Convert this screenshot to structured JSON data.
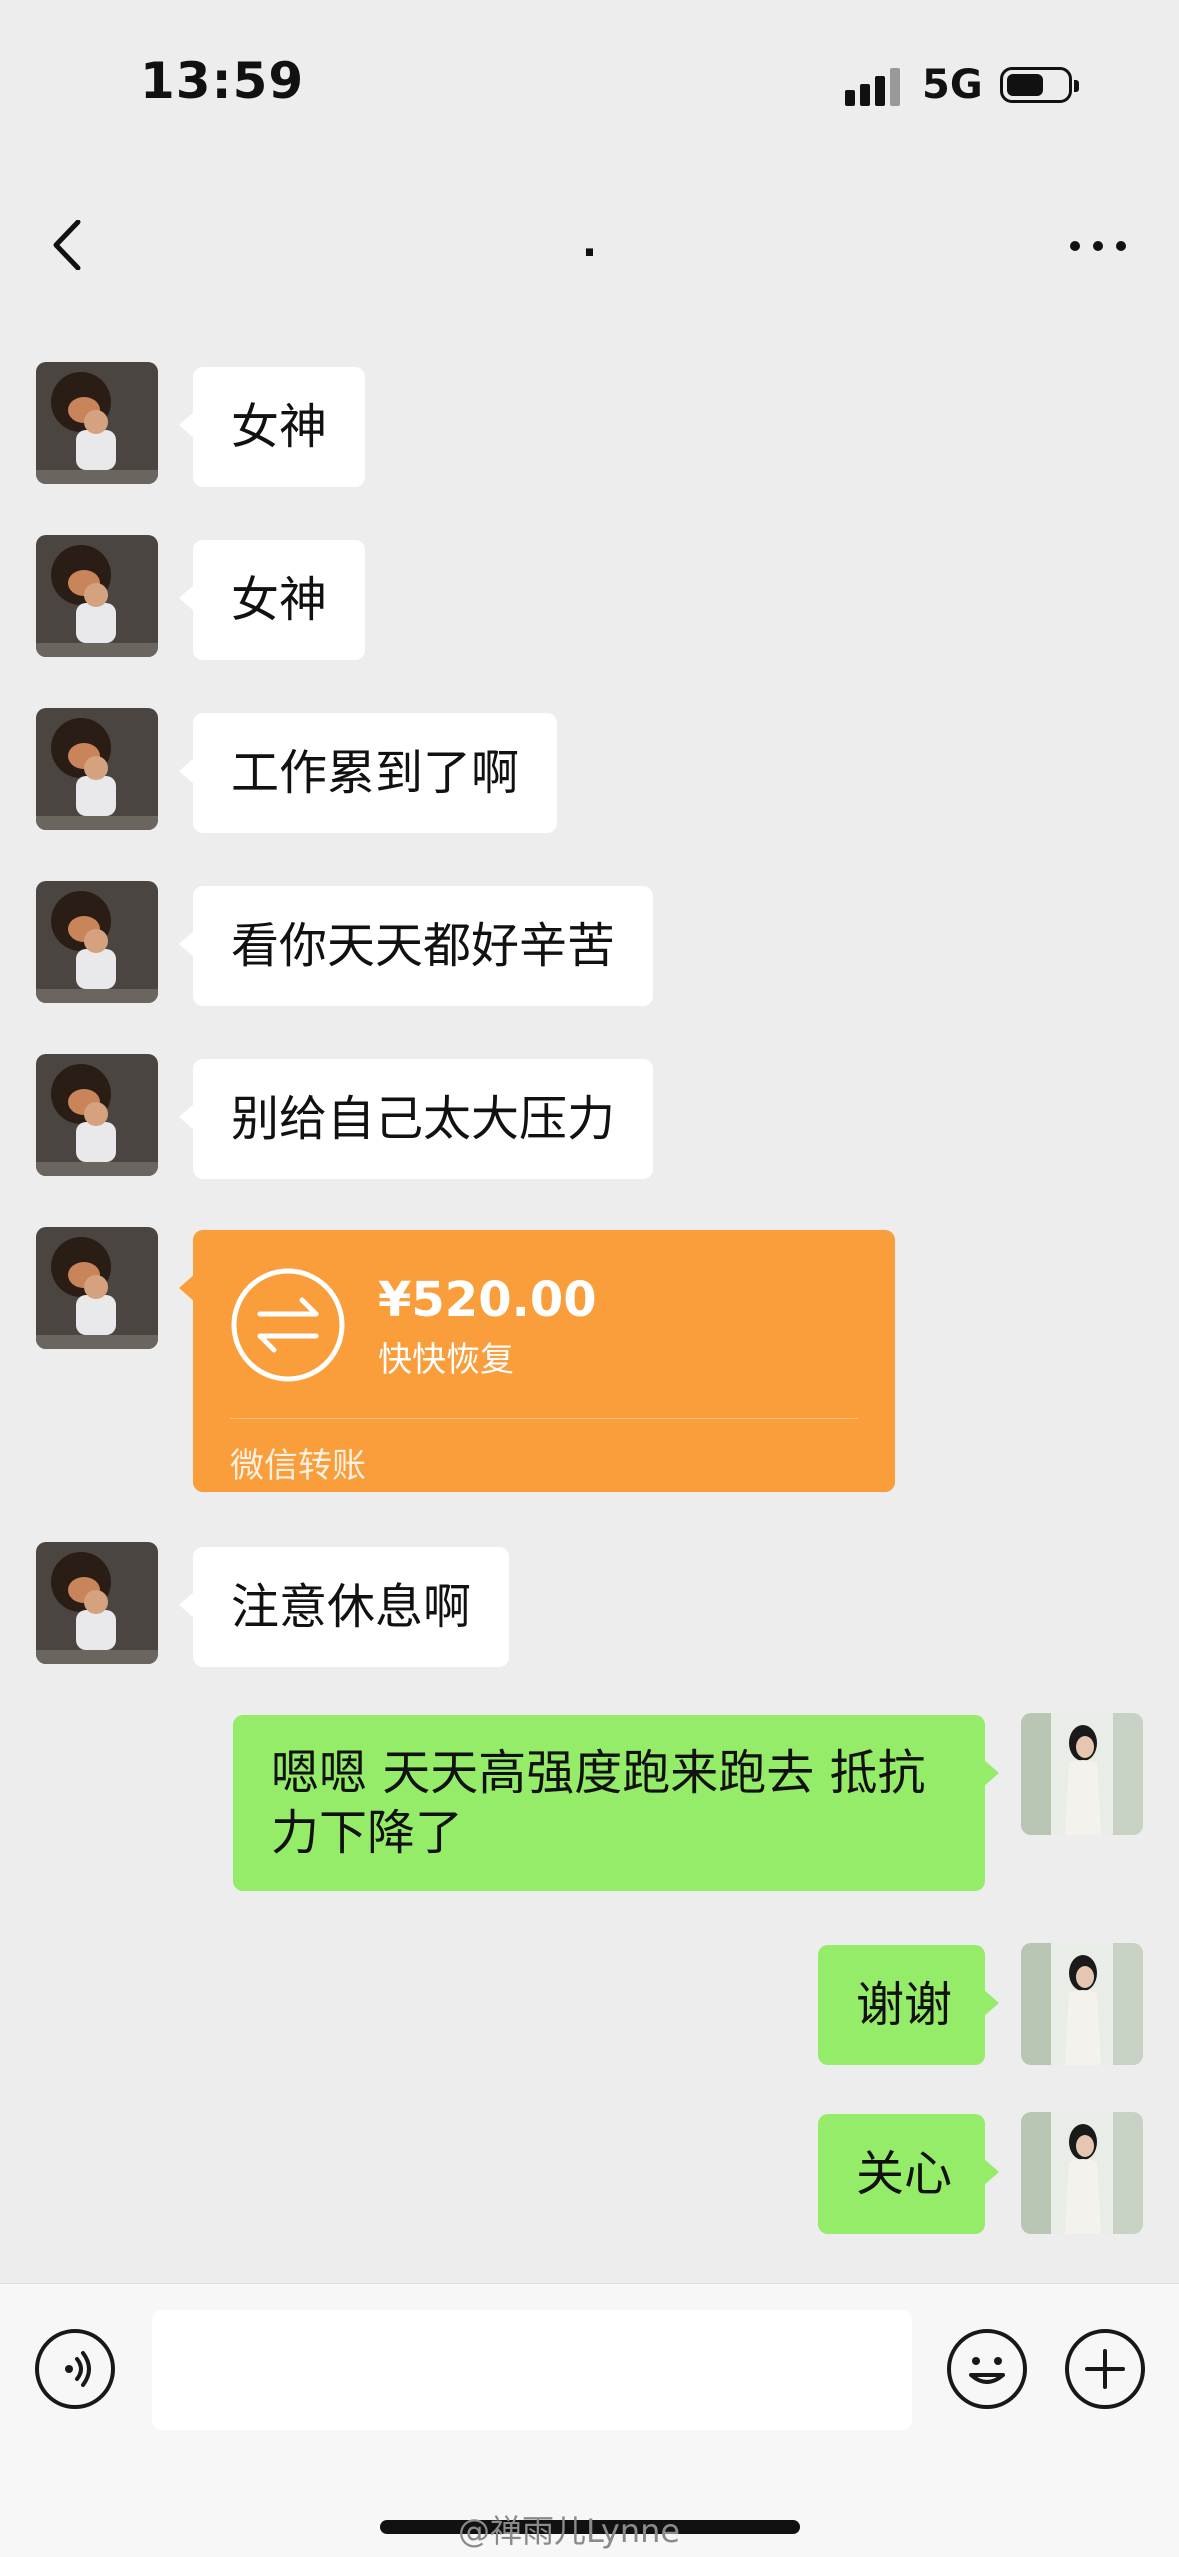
{
  "status_bar": {
    "time": "13:59",
    "network": "5G"
  },
  "nav": {
    "title": "."
  },
  "messages": [
    {
      "side": "in",
      "text": "女神"
    },
    {
      "side": "in",
      "text": "女神"
    },
    {
      "side": "in",
      "text": "工作累到了啊"
    },
    {
      "side": "in",
      "text": "看你天天都好辛苦"
    },
    {
      "side": "in",
      "text": "别给自己太大压力"
    },
    {
      "side": "in",
      "type": "transfer"
    },
    {
      "side": "in",
      "text": "注意休息啊"
    },
    {
      "side": "out",
      "text": "嗯嗯 天天高强度跑来跑去 抵抗力下降了"
    },
    {
      "side": "out",
      "text": "谢谢"
    },
    {
      "side": "out",
      "text": "关心"
    }
  ],
  "transfer": {
    "amount": "¥520.00",
    "note": "快快恢复",
    "label": "微信转账"
  },
  "watermark": "@禅雨儿Lynne",
  "colors": {
    "background": "#ededed",
    "bubble_in": "#ffffff",
    "bubble_out": "#95ec69",
    "transfer": "#fa9d3b"
  }
}
